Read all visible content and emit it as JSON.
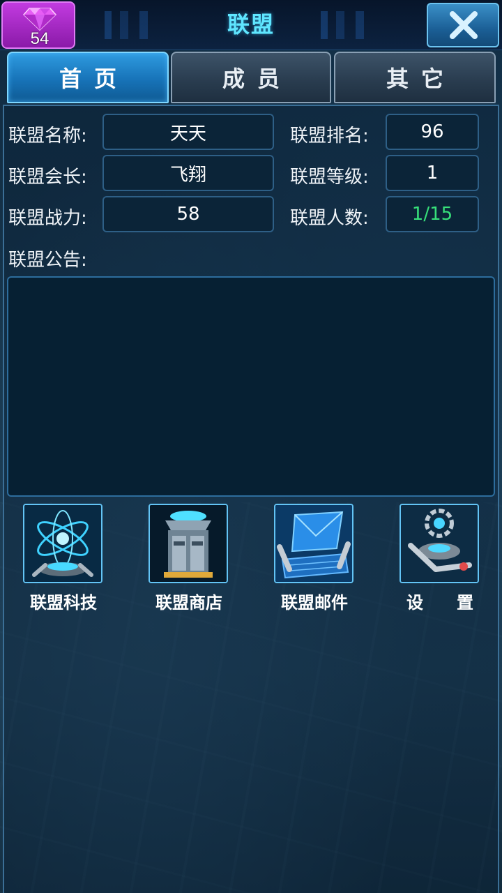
{
  "header": {
    "gem_count": "54",
    "title": "联盟"
  },
  "tabs": [
    {
      "label": "首页",
      "active": true
    },
    {
      "label": "成员",
      "active": false
    },
    {
      "label": "其它",
      "active": false
    }
  ],
  "info": {
    "name_label": "联盟名称:",
    "name_value": "天天",
    "rank_label": "联盟排名:",
    "rank_value": "96",
    "leader_label": "联盟会长:",
    "leader_value": "飞翔",
    "level_label": "联盟等级:",
    "level_value": "1",
    "power_label": "联盟战力:",
    "power_value": "58",
    "members_label": "联盟人数:",
    "members_value": "1/15",
    "notice_label": "联盟公告:",
    "notice_text": ""
  },
  "features": [
    {
      "label": "联盟科技",
      "icon": "tech-atom-icon"
    },
    {
      "label": "联盟商店",
      "icon": "shop-building-icon"
    },
    {
      "label": "联盟邮件",
      "icon": "mail-laptop-icon"
    },
    {
      "label": "设　　置",
      "icon": "settings-gear-icon"
    }
  ],
  "colors": {
    "accent": "#5fe6ff",
    "gem": "#c23be0",
    "members_value": "#37e07a",
    "tab_active": "#1773b8"
  }
}
